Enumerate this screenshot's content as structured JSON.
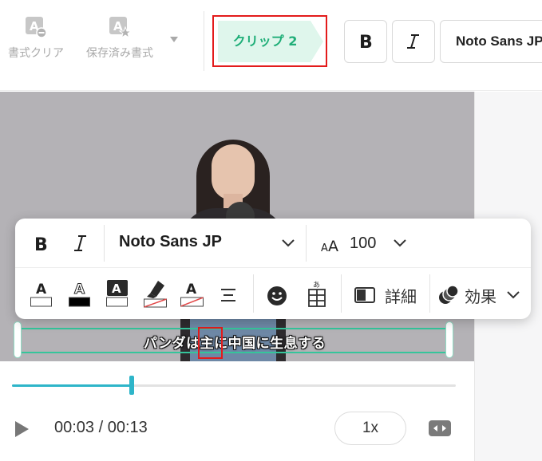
{
  "toolbar": {
    "clear_format_label": "書式クリア",
    "saved_format_label": "保存済み書式",
    "clip_tag_label": "クリップ 2",
    "bold_icon": "bold-icon",
    "italic_icon": "italic-icon",
    "font_name": "Noto Sans JP"
  },
  "video": {
    "subtitle_text": "パンダは主に中国に生息する"
  },
  "text_panel": {
    "font_name": "Noto Sans JP",
    "font_size": "100",
    "detail_label": "詳細",
    "effect_label": "効果"
  },
  "player": {
    "time_display": "00:03 / 00:13",
    "speed_label": "1x",
    "progress_fraction": 0.27
  },
  "colors": {
    "accent_green": "#35c59b",
    "clip_tag_bg": "#dff6ec",
    "clip_tag_text": "#1fae78",
    "highlight_red": "#e31b1b",
    "timeline_blue": "#2eb5c9"
  }
}
